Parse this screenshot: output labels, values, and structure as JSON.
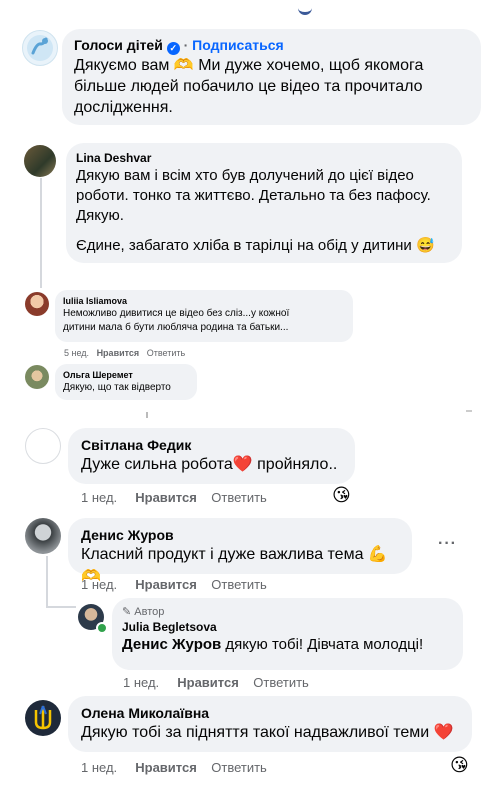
{
  "comments": [
    {
      "name": "Голоси дітей",
      "verified": true,
      "subscribe_label": "Подписаться",
      "text_lines": [
        "Дякуємо вам 🫶 Ми дуже хочемо, щоб якомога",
        "більше людей побачило це відео та прочитало",
        "дослідження."
      ]
    },
    {
      "name": "Lina Deshvar",
      "text_lines": [
        "Дякую вам і всім хто був долучений до цієї відео",
        "роботи. тонко та життєво. Детально та без пафосу.",
        "Дякую."
      ],
      "text_extra": "Єдине, забагато хліба в тарілці на обід у дитини 😅"
    },
    {
      "name": "Iuliia Isliamova",
      "text_lines": [
        "Неможливо дивитися це відео без сліз...у кожної",
        "дитини мала б бути любляча родина та батьки..."
      ],
      "time": "5 нед.",
      "like": "Нравится",
      "reply": "Ответить"
    },
    {
      "name": "Ольга Шеремет",
      "text_lines": [
        "Дякую, що так відверто"
      ]
    },
    {
      "name": "Світлана Федик",
      "text": "Дуже сильна робота❤️ пройняло..",
      "time": "1 нед.",
      "like": "Нравится",
      "reply": "Ответить",
      "reaction": "😘"
    },
    {
      "name": "Денис Журов",
      "text": "Класний продукт і дуже важлива тема 💪🫶",
      "time": "1 нед.",
      "like": "Нравится",
      "reply": "Ответить",
      "more": "···"
    },
    {
      "author_badge": "✎ Автор",
      "name": "Julia Begletsova",
      "mention": "Денис Журов",
      "text": " дякую тобі! Дівчата молодці!",
      "time": "1 нед.",
      "like": "Нравится",
      "reply": "Ответить"
    },
    {
      "name": "Олена Миколаївна",
      "text": "Дякую тобі за підняття такої надважливої теми ❤️",
      "time": "1 нед.",
      "like": "Нравится",
      "reply": "Ответить",
      "reaction": "😘"
    }
  ],
  "colors": {
    "bubble": "#f0f2f5",
    "link": "#0866ff",
    "meta": "#65676b"
  }
}
